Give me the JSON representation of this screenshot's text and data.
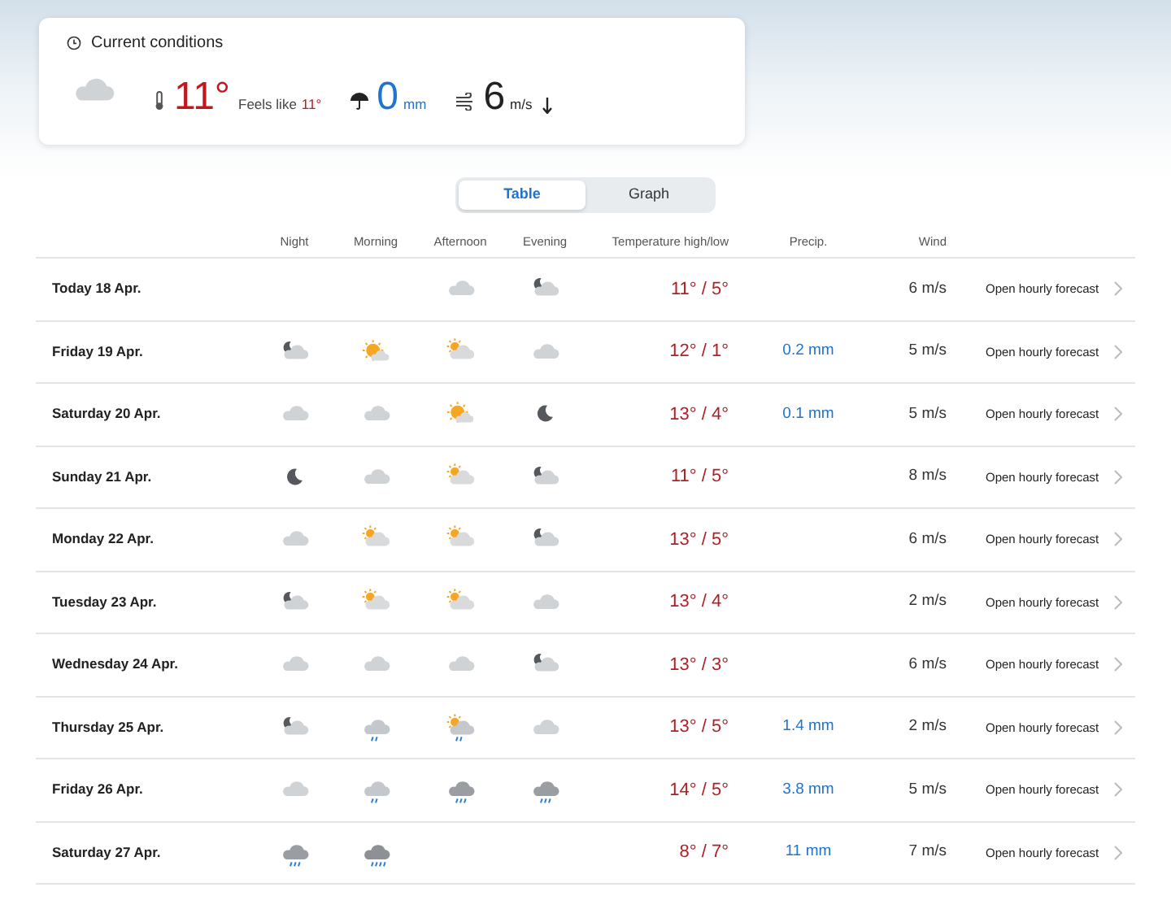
{
  "current": {
    "title": "Current conditions",
    "temperature": "11°",
    "feels_like_label": "Feels like",
    "feels_like": "11°",
    "precipitation": "0",
    "precipitation_unit": "mm",
    "wind": "6",
    "wind_unit": "m/s"
  },
  "tabs": [
    {
      "label": "Table",
      "selected": true
    },
    {
      "label": "Graph",
      "selected": false
    }
  ],
  "columns": [
    "Night",
    "Morning",
    "Afternoon",
    "Evening",
    "Temperature high/low",
    "Precip.",
    "Wind"
  ],
  "rows": [
    {
      "date": "Today 18 Apr.",
      "afternoon": {
        "kind": "cloudy"
      },
      "evening": {
        "kind": "moon-cloud"
      },
      "temperature": "11° / 5°",
      "wind": "6 m/s",
      "link": "Open hourly forecast"
    },
    {
      "date": "Friday 19 Apr.",
      "night": {
        "kind": "moon-cloud"
      },
      "morning": {
        "kind": "sun"
      },
      "afternoon": {
        "kind": "sun-cloud"
      },
      "evening": {
        "kind": "cloudy"
      },
      "temperature": "12° / 1°",
      "precipitation": "0.2 mm",
      "wind": "5 m/s",
      "link": "Open hourly forecast"
    },
    {
      "date": "Saturday 20 Apr.",
      "night": {
        "kind": "cloudy"
      },
      "morning": {
        "kind": "cloudy"
      },
      "afternoon": {
        "kind": "sun"
      },
      "evening": {
        "kind": "moon"
      },
      "temperature": "13° / 4°",
      "precipitation": "0.1 mm",
      "wind": "5 m/s",
      "link": "Open hourly forecast"
    },
    {
      "date": "Sunday 21 Apr.",
      "night": {
        "kind": "moon"
      },
      "morning": {
        "kind": "cloudy"
      },
      "afternoon": {
        "kind": "sun-cloud"
      },
      "evening": {
        "kind": "moon-cloud"
      },
      "temperature": "11° / 5°",
      "wind": "8 m/s",
      "link": "Open hourly forecast"
    },
    {
      "date": "Monday 22 Apr.",
      "night": {
        "kind": "cloudy"
      },
      "morning": {
        "kind": "sun-cloud"
      },
      "afternoon": {
        "kind": "sun-cloud"
      },
      "evening": {
        "kind": "moon-cloud"
      },
      "temperature": "13° / 5°",
      "wind": "6 m/s",
      "link": "Open hourly forecast"
    },
    {
      "date": "Tuesday 23 Apr.",
      "night": {
        "kind": "moon-cloud"
      },
      "morning": {
        "kind": "sun-cloud"
      },
      "afternoon": {
        "kind": "sun-cloud"
      },
      "evening": {
        "kind": "cloudy"
      },
      "temperature": "13° / 4°",
      "wind": "2 m/s",
      "link": "Open hourly forecast"
    },
    {
      "date": "Wednesday 24 Apr.",
      "night": {
        "kind": "cloudy"
      },
      "morning": {
        "kind": "cloudy"
      },
      "afternoon": {
        "kind": "cloudy"
      },
      "evening": {
        "kind": "moon-cloud"
      },
      "temperature": "13° / 3°",
      "wind": "6 m/s",
      "link": "Open hourly forecast"
    },
    {
      "date": "Thursday 25 Apr.",
      "night": {
        "kind": "moon-cloud"
      },
      "morning": {
        "kind": "rain"
      },
      "afternoon": {
        "kind": "sun-rain"
      },
      "evening": {
        "kind": "cloudy"
      },
      "temperature": "13° / 5°",
      "precipitation": "1.4 mm",
      "wind": "2 m/s",
      "link": "Open hourly forecast"
    },
    {
      "date": "Friday 26 Apr.",
      "night": {
        "kind": "cloudy"
      },
      "morning": {
        "kind": "rain"
      },
      "afternoon": {
        "kind": "dark-rain"
      },
      "evening": {
        "kind": "dark-rain"
      },
      "temperature": "14° / 5°",
      "precipitation": "3.8 mm",
      "wind": "5 m/s",
      "link": "Open hourly forecast"
    },
    {
      "date": "Saturday 27 Apr.",
      "night": {
        "kind": "dark-rain"
      },
      "morning": {
        "kind": "heavy-rain"
      },
      "temperature": "8° / 7°",
      "precipitation": "11 mm",
      "wind": "7 m/s",
      "link": "Open hourly forecast"
    }
  ]
}
